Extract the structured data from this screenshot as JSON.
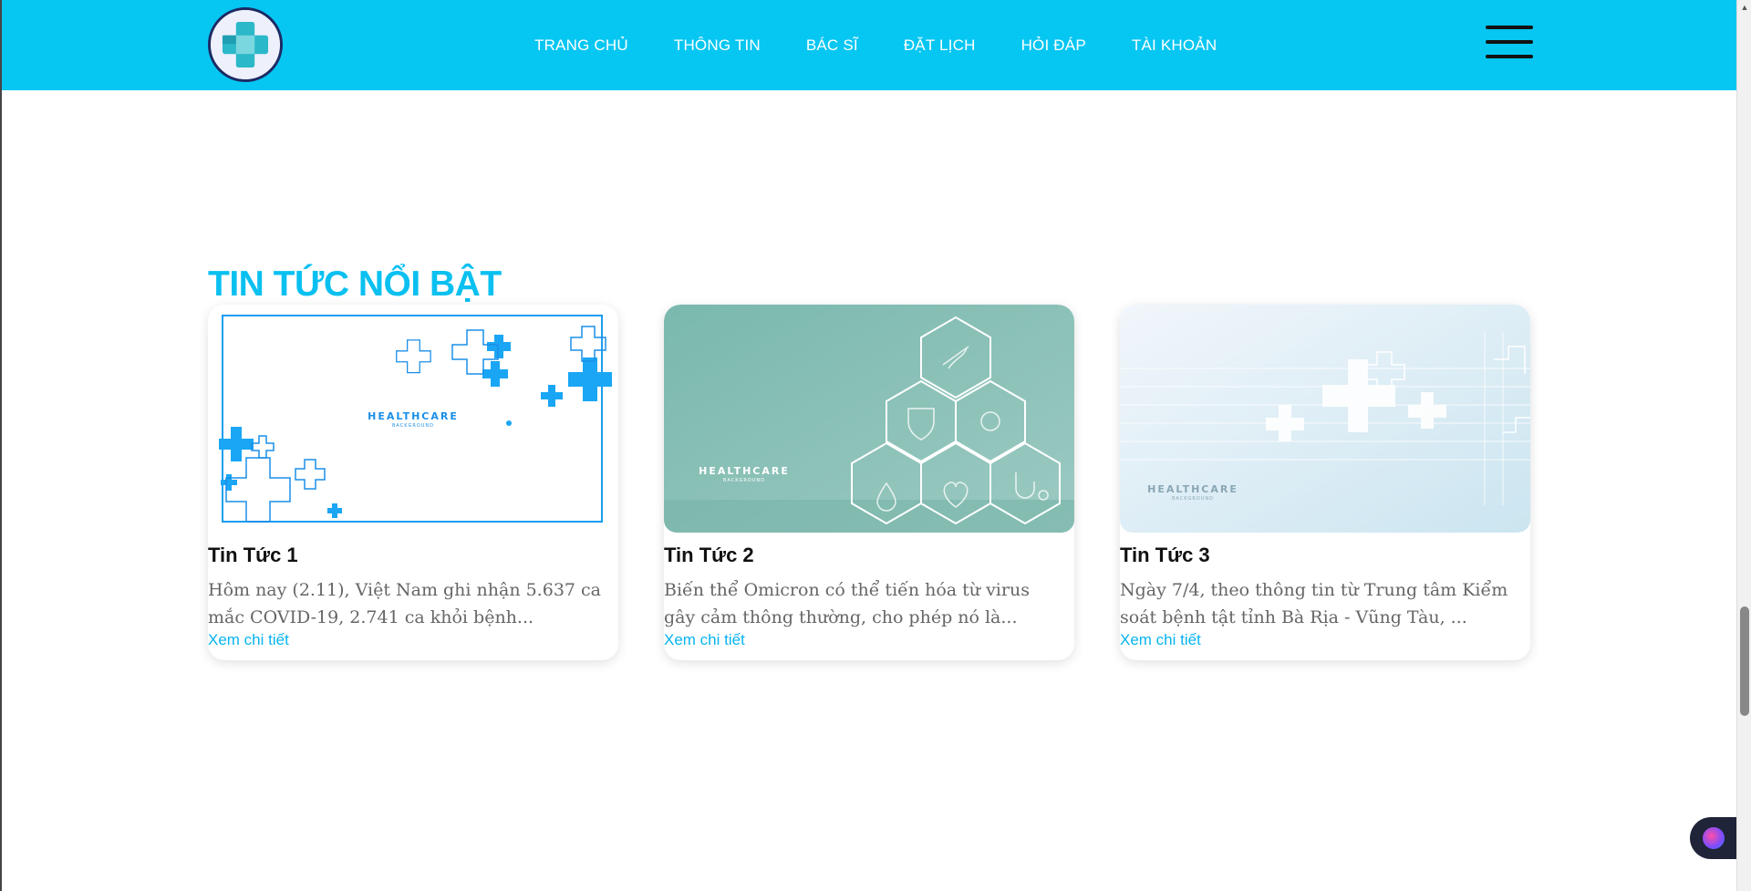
{
  "header": {
    "nav": [
      "TRANG CHỦ",
      "THÔNG TIN",
      "BÁC SĨ",
      "ĐẶT LỊCH",
      "HỎI ĐÁP",
      "TÀI KHOẢN"
    ]
  },
  "section": {
    "title": "TIN TỨC NỔI BẬT"
  },
  "cards": [
    {
      "image_text": "HEALTHCARE",
      "image_subtext": "BACKGROUND",
      "title": "Tin Tức 1",
      "text": "Hôm nay (2.11), Việt Nam ghi nhận 5.637 ca mắc COVID-19, 2.741 ca khỏi bệnh...",
      "link": "Xem chi tiết"
    },
    {
      "image_text": "HEALTHCARE",
      "image_subtext": "BACKGROUND",
      "title": "Tin Tức 2",
      "text": "Biến thể Omicron có thể tiến hóa từ virus gây cảm thông thường, cho phép nó là...",
      "link": "Xem chi tiết"
    },
    {
      "image_text": "HEALTHCARE",
      "image_subtext": "BACKGROUND",
      "title": "Tin Tức 3",
      "text": "Ngày 7/4, theo thông tin từ Trung tâm Kiểm soát bệnh tật tỉnh Bà Rịa - Vũng Tàu, ...",
      "link": "Xem chi tiết"
    }
  ],
  "colors": {
    "header_bg": "#06c6f2",
    "accent": "#0ac0f0",
    "link": "#06b4ef"
  },
  "icons": [
    "medical-cross-logo-icon",
    "hamburger-menu-icon",
    "scroll-up-arrow-icon",
    "assistant-widget-icon"
  ]
}
